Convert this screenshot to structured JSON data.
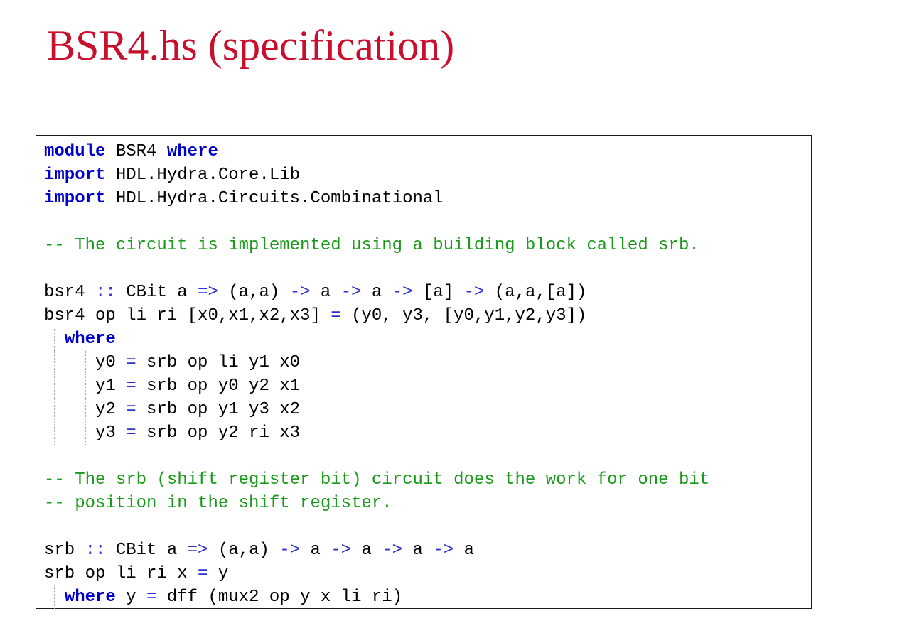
{
  "title": "BSR4.hs (specification)",
  "colors": {
    "title": "#c8102e",
    "keyword": "#0000cc",
    "comment": "#1a9a1a",
    "operator": "#2d32cc",
    "text": "#000000",
    "border": "#1a1a1a",
    "guide": "#a8a8a8"
  },
  "code": [
    {
      "tokens": [
        {
          "t": "module",
          "k": "kw"
        },
        {
          "t": " BSR4 ",
          "k": "tx"
        },
        {
          "t": "where",
          "k": "kw"
        }
      ]
    },
    {
      "tokens": [
        {
          "t": "import",
          "k": "kw"
        },
        {
          "t": " HDL.Hydra.Core.Lib",
          "k": "tx"
        }
      ]
    },
    {
      "tokens": [
        {
          "t": "import",
          "k": "kw"
        },
        {
          "t": " HDL.Hydra.Circuits.Combinational",
          "k": "tx"
        }
      ]
    },
    {
      "tokens": []
    },
    {
      "tokens": [
        {
          "t": "-- The circuit is implemented using a building block called srb.",
          "k": "cm"
        }
      ]
    },
    {
      "tokens": []
    },
    {
      "tokens": [
        {
          "t": "bsr4 ",
          "k": "tx"
        },
        {
          "t": "::",
          "k": "op"
        },
        {
          "t": " CBit a ",
          "k": "tx"
        },
        {
          "t": "=>",
          "k": "op"
        },
        {
          "t": " (a,a) ",
          "k": "tx"
        },
        {
          "t": "->",
          "k": "op"
        },
        {
          "t": " a ",
          "k": "tx"
        },
        {
          "t": "->",
          "k": "op"
        },
        {
          "t": " a ",
          "k": "tx"
        },
        {
          "t": "->",
          "k": "op"
        },
        {
          "t": " [a] ",
          "k": "tx"
        },
        {
          "t": "->",
          "k": "op"
        },
        {
          "t": " (a,a,[a])",
          "k": "tx"
        }
      ]
    },
    {
      "tokens": [
        {
          "t": "bsr4 op li ri [x0,x1,x2,x3] ",
          "k": "tx"
        },
        {
          "t": "=",
          "k": "op"
        },
        {
          "t": " (y0, y3, [y0,y1,y2,y3])",
          "k": "tx"
        }
      ]
    },
    {
      "guides": [
        1
      ],
      "tokens": [
        {
          "t": "  ",
          "k": "tx"
        },
        {
          "t": "where",
          "k": "kw"
        }
      ]
    },
    {
      "guides": [
        1,
        4
      ],
      "tokens": [
        {
          "t": "     y0 ",
          "k": "tx"
        },
        {
          "t": "=",
          "k": "op"
        },
        {
          "t": " srb op li y1 x0",
          "k": "tx"
        }
      ]
    },
    {
      "guides": [
        1,
        4
      ],
      "tokens": [
        {
          "t": "     y1 ",
          "k": "tx"
        },
        {
          "t": "=",
          "k": "op"
        },
        {
          "t": " srb op y0 y2 x1",
          "k": "tx"
        }
      ]
    },
    {
      "guides": [
        1,
        4
      ],
      "tokens": [
        {
          "t": "     y2 ",
          "k": "tx"
        },
        {
          "t": "=",
          "k": "op"
        },
        {
          "t": " srb op y1 y3 x2",
          "k": "tx"
        }
      ]
    },
    {
      "guides": [
        1,
        4
      ],
      "tokens": [
        {
          "t": "     y3 ",
          "k": "tx"
        },
        {
          "t": "=",
          "k": "op"
        },
        {
          "t": " srb op y2 ri x3",
          "k": "tx"
        }
      ]
    },
    {
      "tokens": []
    },
    {
      "tokens": [
        {
          "t": "-- The srb (shift register bit) circuit does the work for one bit",
          "k": "cm"
        }
      ]
    },
    {
      "tokens": [
        {
          "t": "-- position in the shift register.",
          "k": "cm"
        }
      ]
    },
    {
      "tokens": []
    },
    {
      "tokens": [
        {
          "t": "srb ",
          "k": "tx"
        },
        {
          "t": "::",
          "k": "op"
        },
        {
          "t": " CBit a ",
          "k": "tx"
        },
        {
          "t": "=>",
          "k": "op"
        },
        {
          "t": " (a,a) ",
          "k": "tx"
        },
        {
          "t": "->",
          "k": "op"
        },
        {
          "t": " a ",
          "k": "tx"
        },
        {
          "t": "->",
          "k": "op"
        },
        {
          "t": " a ",
          "k": "tx"
        },
        {
          "t": "->",
          "k": "op"
        },
        {
          "t": " a ",
          "k": "tx"
        },
        {
          "t": "->",
          "k": "op"
        },
        {
          "t": " a",
          "k": "tx"
        }
      ]
    },
    {
      "tokens": [
        {
          "t": "srb op li ri x ",
          "k": "tx"
        },
        {
          "t": "=",
          "k": "op"
        },
        {
          "t": " y",
          "k": "tx"
        }
      ]
    },
    {
      "guides": [
        1
      ],
      "tokens": [
        {
          "t": "  ",
          "k": "tx"
        },
        {
          "t": "where",
          "k": "kw"
        },
        {
          "t": " y ",
          "k": "tx"
        },
        {
          "t": "=",
          "k": "op"
        },
        {
          "t": " dff (mux2 op y x li ri)",
          "k": "tx"
        }
      ]
    }
  ]
}
